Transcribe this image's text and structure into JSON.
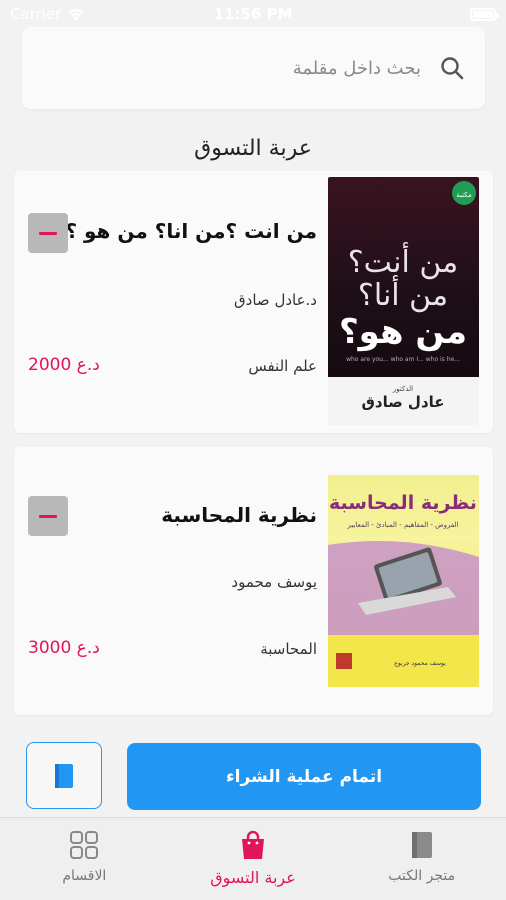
{
  "status_bar": {
    "carrier": "Carrier",
    "time": "11:56 PM"
  },
  "search": {
    "placeholder": "بحث داخل مقلمة"
  },
  "cart": {
    "title": "عربة التسوق",
    "items": [
      {
        "title": "من انت ؟من انا؟ من هو ؟",
        "author": "د.عادل صادق",
        "category": "علم النفس",
        "price": "2000 د.ع",
        "cover": {
          "main_text": "من أنت؟ من أنا؟ من هو؟",
          "subtitle": "who are you... who am I... who is he...",
          "author_label": "الدكتور",
          "author": "عادل صادق",
          "badge": "مكتبة"
        }
      },
      {
        "title": "نظرية المحاسبة",
        "author": "يوسف محمود",
        "category": "المحاسبة",
        "price": "3000 د.ع",
        "cover": {
          "main_text": "نظرية المحاسبة",
          "subtitle": "الفروض - المفاهيم - المبادئ - المعايير",
          "author": "يوسف محمود جربوع"
        }
      }
    ]
  },
  "actions": {
    "checkout_label": "اتمام عملية الشراء"
  },
  "tabbar": {
    "tabs": [
      {
        "label": "الاقسام",
        "icon": "grid-icon",
        "active": false
      },
      {
        "label": "عربة التسوق",
        "icon": "shopping-bag-icon",
        "active": true
      },
      {
        "label": "متجر الكتب",
        "icon": "book-icon",
        "active": false
      }
    ]
  },
  "colors": {
    "accent": "#2196f3",
    "price": "#e0155a",
    "active_tab": "#e0155a"
  }
}
